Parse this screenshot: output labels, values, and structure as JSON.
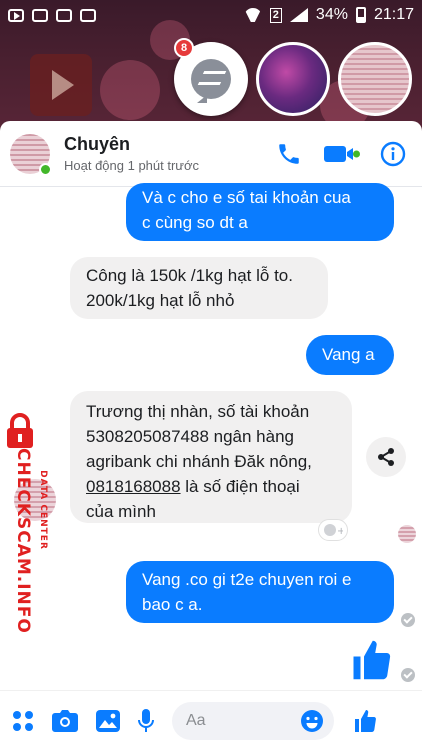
{
  "status_bar": {
    "sim_badge": "2",
    "battery_percent": "34%",
    "time": "21:17"
  },
  "chat_heads": {
    "messenger_unread_count": "8"
  },
  "header": {
    "contact_name": "Chuyên",
    "active_status": "Hoạt động 1 phút trước",
    "icons": [
      "phone-icon",
      "video-call-icon",
      "info-icon"
    ]
  },
  "messages": [
    {
      "direction": "out",
      "lines": [
        "Và c cho e số tai khoản cua",
        "c cùng so dt a"
      ]
    },
    {
      "direction": "in",
      "lines": [
        "Công là 150k /1kg hạt lỗ to.",
        "200k/1kg hạt lỗ nhỏ"
      ]
    },
    {
      "direction": "out",
      "lines": [
        "Vang a"
      ]
    },
    {
      "direction": "in",
      "lines": [
        "Trương thị nhàn, số tài khoản",
        "5308205087488 ngân hàng",
        "agribank chi nhánh Đăk nông,"
      ],
      "phone": "0818168088",
      "phone_suffix": " là số điện thoại",
      "last_line": "của mình"
    },
    {
      "direction": "out",
      "lines": [
        "Vang .co gi t2e chuyen roi e",
        "bao c a."
      ]
    }
  ],
  "watermark": {
    "brand": "CHECKSCAM.INFO",
    "sub": "DATA CENTER"
  },
  "composer": {
    "placeholder": "Aa",
    "icons": [
      "more-apps-icon",
      "camera-icon",
      "gallery-icon",
      "microphone-icon",
      "emoji-icon",
      "like-icon"
    ]
  },
  "colors": {
    "outgoing_bubble": "#0a7cff",
    "incoming_bubble": "#f1f0f0",
    "accent": "#0a7cff",
    "online": "#42b72a",
    "badge": "#e63b3b",
    "watermark": "#e02020"
  }
}
